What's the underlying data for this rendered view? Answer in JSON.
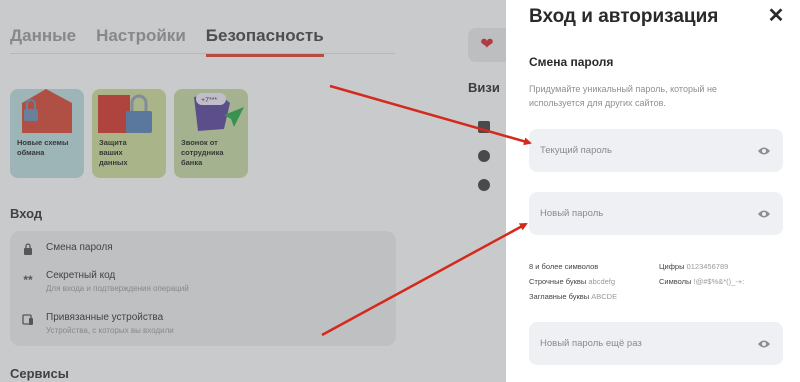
{
  "background": {
    "tabs": [
      "Данные",
      "Настройки",
      "Безопасность"
    ],
    "cards": [
      {
        "label": "Новые схемы обмана"
      },
      {
        "label": "Защита ваших данных"
      },
      {
        "label": "Звонок от сотрудника банка"
      }
    ],
    "card_art_text": "+7***",
    "login_section": {
      "title": "Вход",
      "items": [
        {
          "title": "Смена пароля",
          "subtitle": "",
          "icon": "lock-icon"
        },
        {
          "title": "Секретный код",
          "subtitle": "Для входа и подтверждения операций",
          "icon": "asterisks-icon"
        },
        {
          "title": "Привязанные устройства",
          "subtitle": "Устройства, с которых вы входили",
          "icon": "devices-icon"
        }
      ]
    },
    "services_title": "Сервисы",
    "right_title": "Визи"
  },
  "panel": {
    "title": "Вход и авторизация",
    "close_icon": "close-icon",
    "section_title": "Смена пароля",
    "description": "Придумайте уникальный пароль, который не используется для других сайтов.",
    "fields": {
      "current": {
        "placeholder": "Текущий пароль"
      },
      "new": {
        "placeholder": "Новый пароль"
      },
      "repeat": {
        "placeholder": "Новый пароль ещё раз"
      }
    },
    "requirements": {
      "length": "8 и более символов",
      "lower_label": "Строчные буквы",
      "lower_example": "abcdefg",
      "upper_label": "Заглавные буквы",
      "upper_example": "ABCDE",
      "digits_label": "Цифры",
      "digits_example": "0123456789",
      "symbols_label": "Символы",
      "symbols_example": "!@#$%&*()_-+:"
    }
  },
  "colors": {
    "accent": "#d9483b",
    "arrow": "#d42a1e",
    "field_bg": "#eef0f3"
  }
}
